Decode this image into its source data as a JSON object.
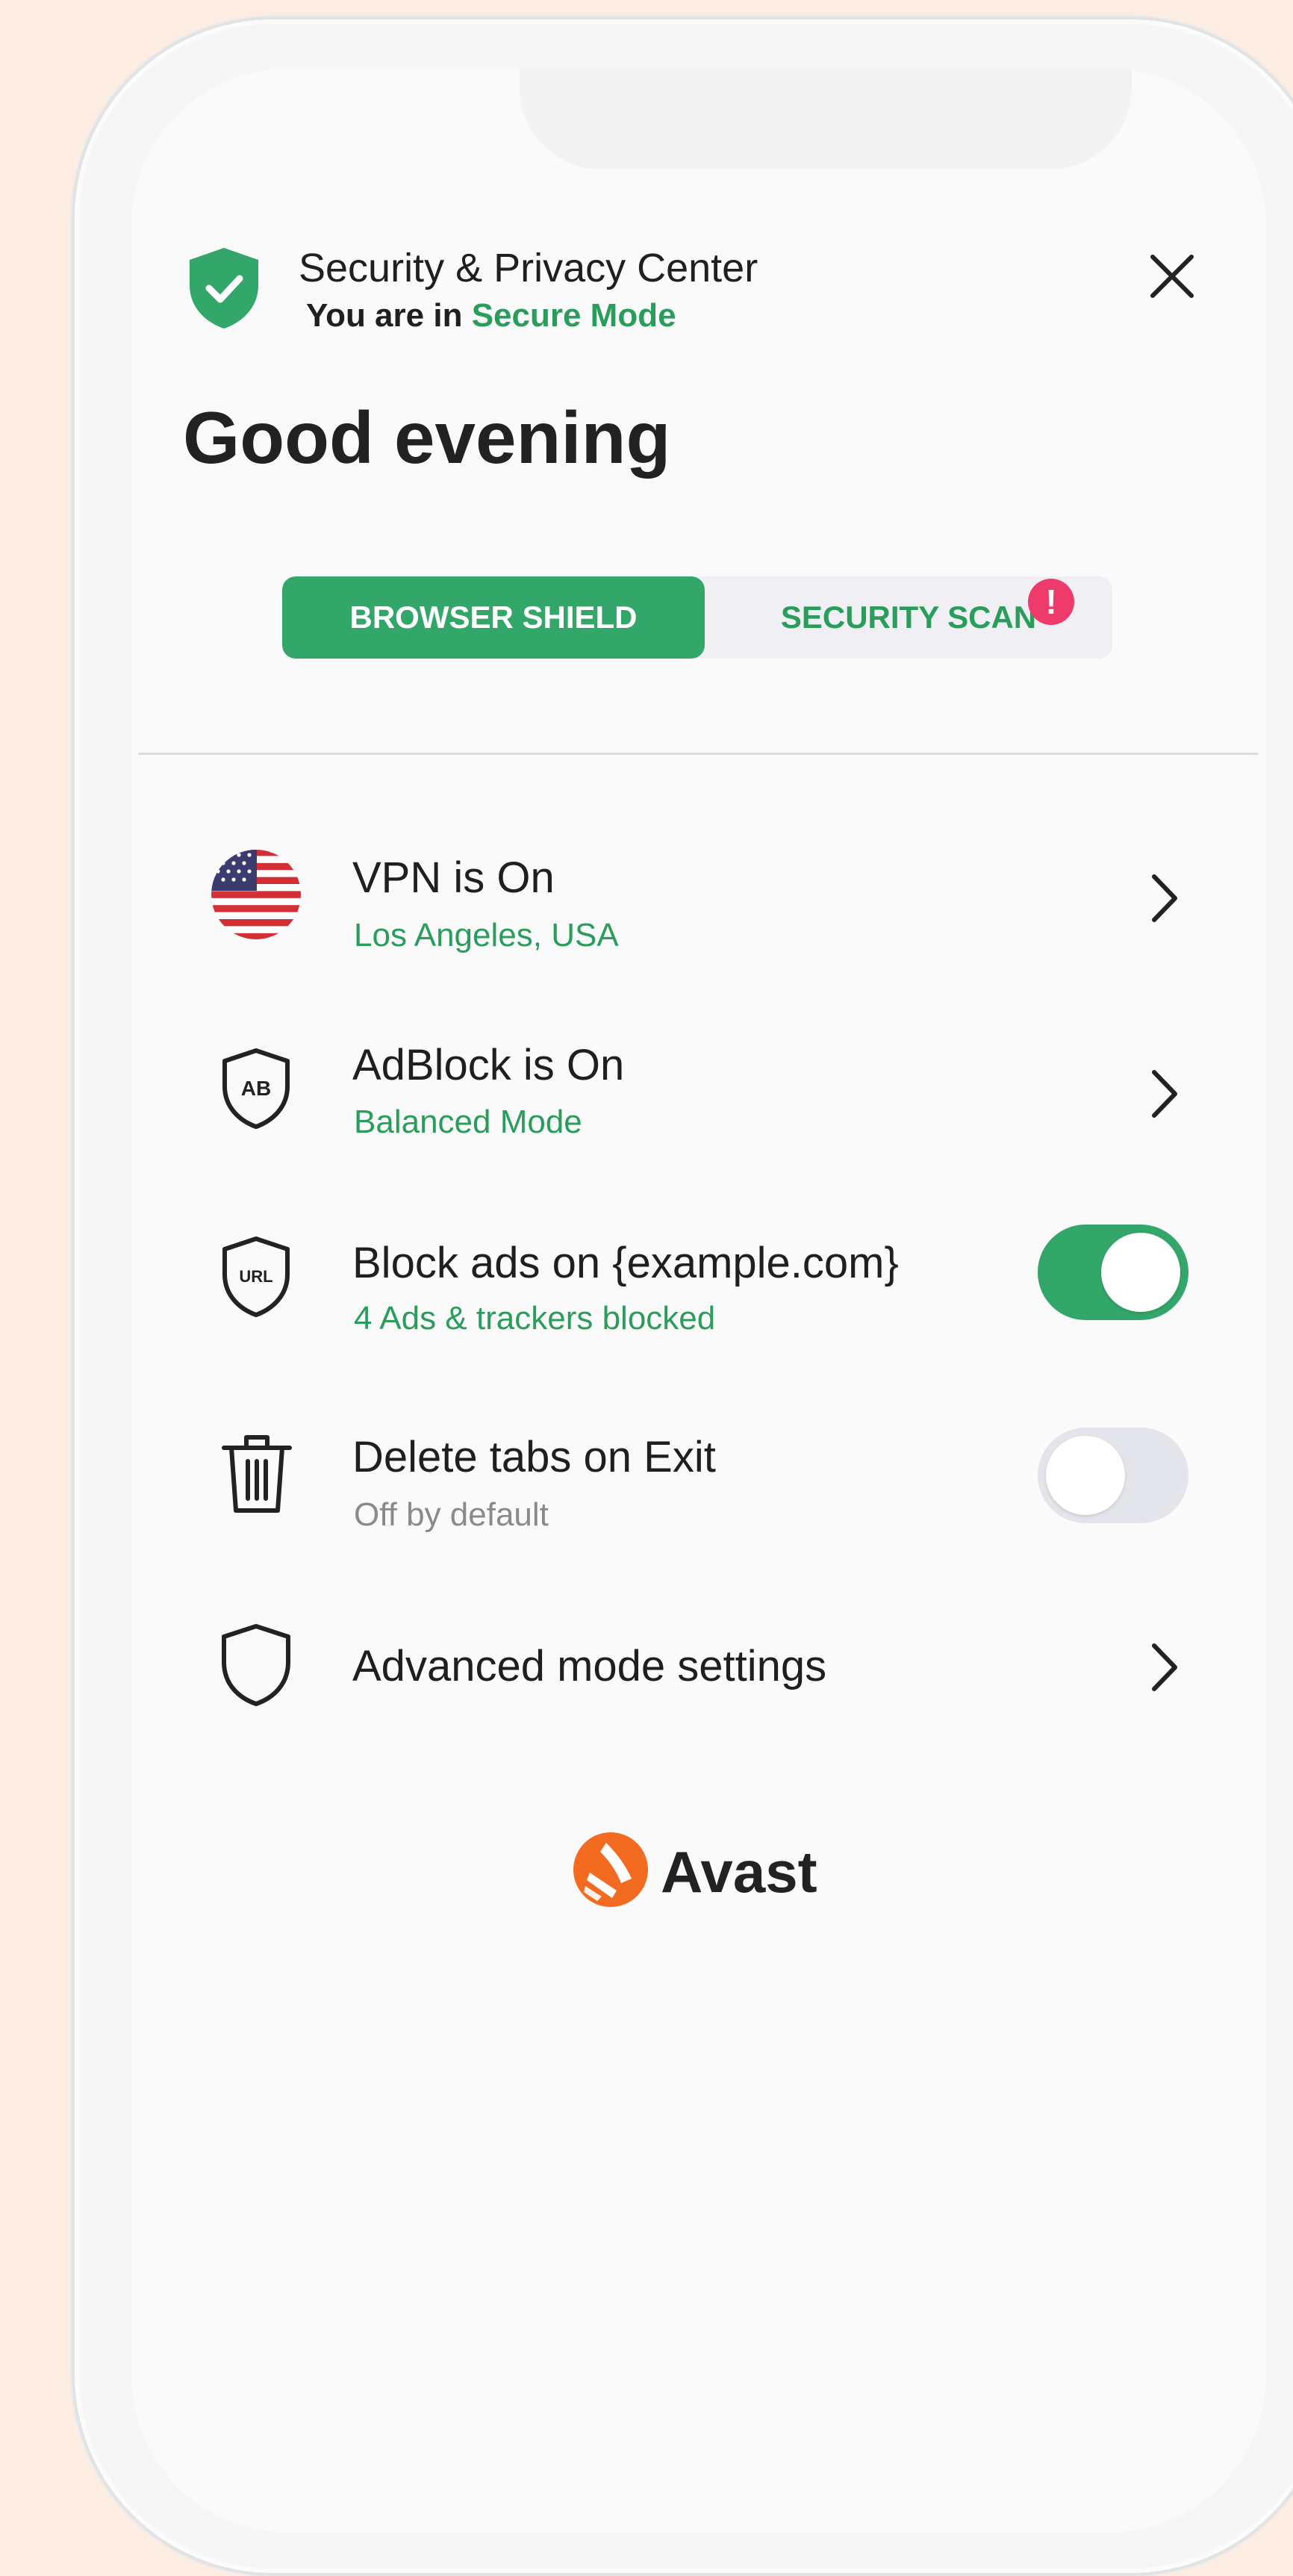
{
  "header": {
    "title": "Security & Privacy Center",
    "mode_prefix": "You are in ",
    "mode_name": "Secure Mode"
  },
  "greeting": "Good evening",
  "tabs": [
    {
      "label": "BROWSER SHIELD",
      "active": true
    },
    {
      "label": "SECURITY SCAN",
      "active": false,
      "badge": "!"
    }
  ],
  "items": [
    {
      "title": "VPN is On",
      "subtitle": "Los Angeles, USA",
      "icon": "us-flag-icon",
      "control": "chevron"
    },
    {
      "title": "AdBlock is On",
      "subtitle": "Balanced Mode",
      "icon": "ab-shield-icon",
      "control": "chevron"
    },
    {
      "title": "Block ads on {example.com}",
      "subtitle": "4 Ads & trackers blocked",
      "icon": "url-shield-icon",
      "control": "toggle",
      "toggle_on": true
    },
    {
      "title": "Delete tabs on Exit",
      "subtitle": "Off by default",
      "icon": "trash-icon",
      "control": "toggle",
      "toggle_on": false
    },
    {
      "title": "Advanced mode settings",
      "icon": "shield-outline-icon",
      "control": "chevron"
    }
  ],
  "brand": {
    "name": "Avast",
    "icon": "avast-logo-icon"
  },
  "colors": {
    "accent": "#33a76a",
    "accent_text": "#2a9d5c",
    "alert": "#ef3b6b",
    "brand": "#f26b21"
  }
}
